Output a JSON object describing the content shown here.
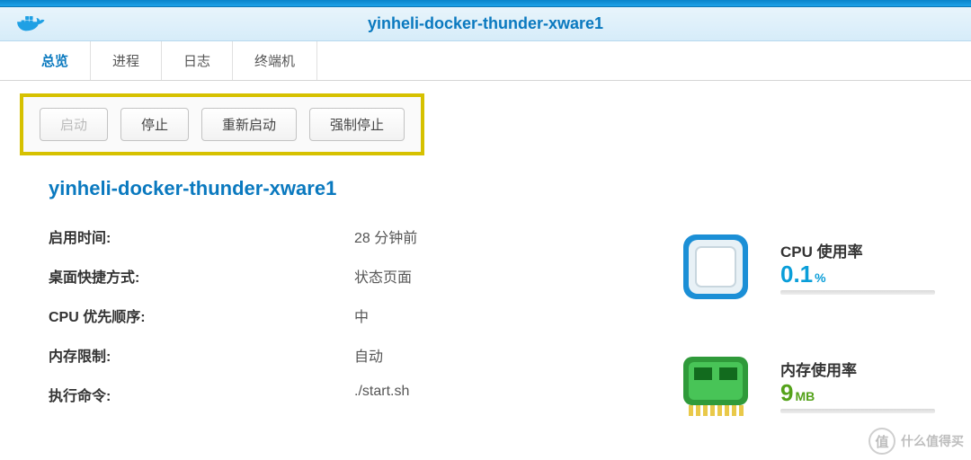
{
  "header": {
    "title": "yinheli-docker-thunder-xware1"
  },
  "tabs": [
    {
      "label": "总览",
      "active": true
    },
    {
      "label": "进程",
      "active": false
    },
    {
      "label": "日志",
      "active": false
    },
    {
      "label": "终端机",
      "active": false
    }
  ],
  "actions": {
    "start": "启动",
    "stop": "停止",
    "restart": "重新启动",
    "force_stop": "强制停止"
  },
  "container": {
    "name": "yinheli-docker-thunder-xware1",
    "info": [
      {
        "label": "启用时间:",
        "value": "28 分钟前"
      },
      {
        "label": "桌面快捷方式:",
        "value": "状态页面"
      },
      {
        "label": "CPU 优先顺序:",
        "value": "中"
      },
      {
        "label": "内存限制:",
        "value": "自动"
      },
      {
        "label": "执行命令:",
        "value": "./start.sh"
      }
    ]
  },
  "stats": {
    "cpu": {
      "title": "CPU 使用率",
      "value": "0.1",
      "unit": "%"
    },
    "mem": {
      "title": "内存使用率",
      "value": "9",
      "unit": "MB"
    }
  },
  "watermark": {
    "symbol": "值",
    "text": "什么值得买"
  }
}
